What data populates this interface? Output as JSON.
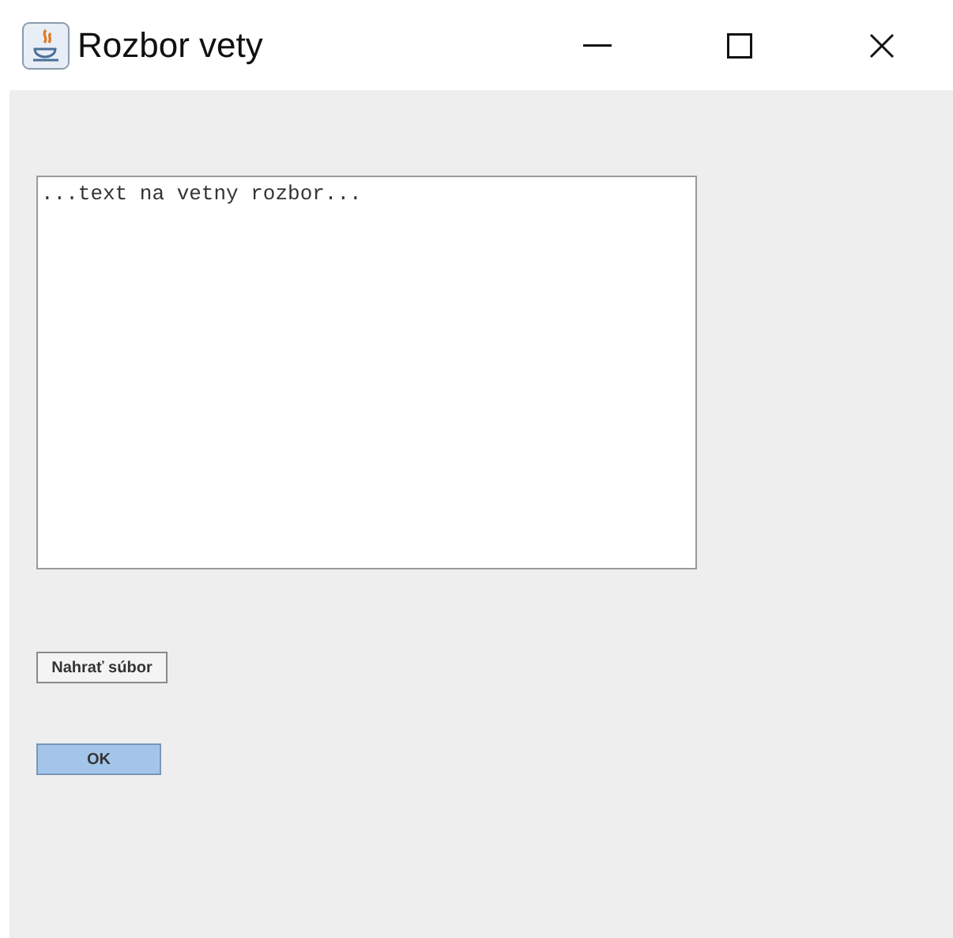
{
  "window": {
    "title": "Rozbor vety"
  },
  "text_area": {
    "value": "...text na vetny rozbor..."
  },
  "buttons": [
    {
      "label": "Nahrať súbor",
      "focused": false
    },
    {
      "label": "OK",
      "focused": true
    }
  ]
}
